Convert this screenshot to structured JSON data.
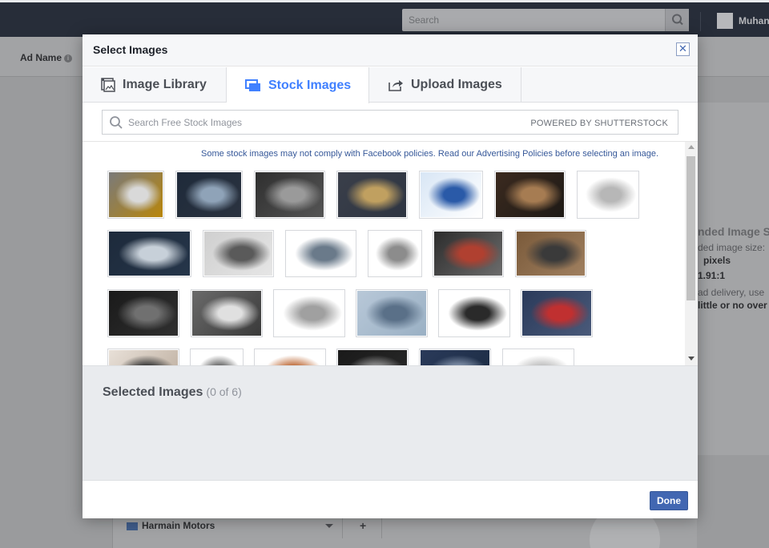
{
  "topbar": {
    "search_placeholder": "Search",
    "user_name": "Muhan"
  },
  "background": {
    "ad_name_label": "Ad Name",
    "info_icon_glyph": "i",
    "right_panel": {
      "heading": "nded Image S",
      "size_label": "ded image size:",
      "size_value": "pixels",
      "ratio_value": "1.91:1",
      "delivery_note": "ad delivery, use",
      "overlay_note": "little or no over"
    },
    "page_dropdown": "Harmain Motors",
    "add_button": "+"
  },
  "modal": {
    "title": "Select Images",
    "close_glyph": "✕",
    "tabs": [
      {
        "label": "Image Library",
        "icon": "image-library-icon"
      },
      {
        "label": "Stock Images",
        "icon": "stock-images-icon",
        "active": true
      },
      {
        "label": "Upload Images",
        "icon": "share-upload-icon"
      }
    ],
    "search": {
      "placeholder": "Search Free Stock Images",
      "value": "",
      "powered_by": "POWERED BY SHUTTERSTOCK"
    },
    "notice": "Some stock images may not comply with Facebook policies. Read our Advertising Policies before selecting an image.",
    "selected": {
      "title": "Selected Images",
      "count": "(0 of 6)"
    },
    "done_label": "Done"
  },
  "colors": {
    "accent": "#4080ff",
    "button": "#4267b2",
    "link": "#365899",
    "topbar": "#272d39"
  },
  "images": [
    {
      "name": "car-parts-assortment",
      "colors": [
        "#7a7a7a",
        "#d9d9d9",
        "#b8860b"
      ]
    },
    {
      "name": "engine-closeup",
      "colors": [
        "#1e2a3a",
        "#8fa3b8",
        "#2b3340"
      ]
    },
    {
      "name": "auto-parts-gray",
      "colors": [
        "#2f2f2f",
        "#9a9a9a",
        "#555555"
      ]
    },
    {
      "name": "mechanic-working",
      "colors": [
        "#3a3f4a",
        "#c0a060",
        "#2e3542"
      ]
    },
    {
      "name": "blue-engine-part",
      "colors": [
        "#d8e6f5",
        "#2a5aa8",
        "#ffffff"
      ]
    },
    {
      "name": "gearbox-metal",
      "colors": [
        "#3b2a1f",
        "#a67c52",
        "#1e1a16"
      ]
    },
    {
      "name": "alloy-wheel",
      "colors": [
        "#ffffff",
        "#b7b7b7",
        "#ffffff"
      ]
    },
    {
      "name": "engine-block-blue",
      "colors": [
        "#1d2a3b",
        "#c7d0d9",
        "#26364a"
      ]
    },
    {
      "name": "parts-on-gray",
      "colors": [
        "#cfcfcf",
        "#5a5a5a",
        "#e6e6e6"
      ]
    },
    {
      "name": "gears-white",
      "colors": [
        "#ffffff",
        "#6a7a8a",
        "#ffffff"
      ]
    },
    {
      "name": "sensors-set",
      "colors": [
        "#ffffff",
        "#8c8c8c",
        "#ffffff"
      ]
    },
    {
      "name": "engine-repair-hands",
      "colors": [
        "#2c2c2c",
        "#b04030",
        "#6c6c6c"
      ]
    },
    {
      "name": "rusty-parts-pile",
      "colors": [
        "#7a5a3a",
        "#3a3a3a",
        "#a08060"
      ]
    },
    {
      "name": "black-parts-set",
      "colors": [
        "#1a1a1a",
        "#707070",
        "#303030"
      ]
    },
    {
      "name": "engine-top-view",
      "colors": [
        "#6a6a6a",
        "#e0e0e0",
        "#3a3a3a"
      ]
    },
    {
      "name": "bearings-white",
      "colors": [
        "#ffffff",
        "#a0a0a0",
        "#ffffff"
      ]
    },
    {
      "name": "factory-line",
      "colors": [
        "#b8c8d8",
        "#5a7088",
        "#9ab0c4"
      ]
    },
    {
      "name": "steering-switch",
      "colors": [
        "#ffffff",
        "#2a2a2a",
        "#ffffff"
      ]
    },
    {
      "name": "mechanic-red-shirt",
      "colors": [
        "#2a3a5a",
        "#c03030",
        "#4a5a7a"
      ]
    },
    {
      "name": "mechanic-smiling",
      "colors": [
        "#e8e0d8",
        "#3a3a3a",
        "#b8a898"
      ]
    },
    {
      "name": "new-auto-spare-parts",
      "colors": [
        "#ffffff",
        "#6a6a6a",
        "#ffffff"
      ]
    },
    {
      "name": "copper-part",
      "colors": [
        "#ffffff",
        "#c07040",
        "#ffffff"
      ]
    },
    {
      "name": "gear-dark",
      "colors": [
        "#1a1a1a",
        "#909090",
        "#2a2a2a"
      ]
    },
    {
      "name": "engine-blue",
      "colors": [
        "#2a3a5a",
        "#8090a8",
        "#1a2a40"
      ]
    },
    {
      "name": "white-part",
      "colors": [
        "#ffffff",
        "#c0c0c0",
        "#ffffff"
      ]
    }
  ]
}
